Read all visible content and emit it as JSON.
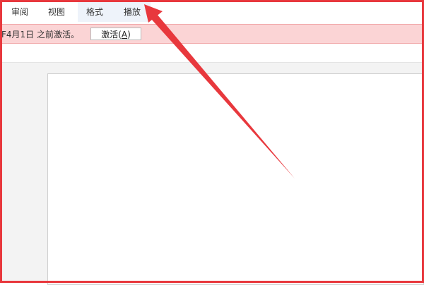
{
  "ribbon": {
    "tabs": [
      {
        "label": "审阅"
      },
      {
        "label": "视图"
      },
      {
        "label": "格式"
      },
      {
        "label": "播放"
      }
    ]
  },
  "infobar": {
    "message": "F4月1日 之前激活。",
    "activate_label": "激活",
    "activate_accel": "A"
  },
  "annotation": {
    "color": "#e8383d"
  }
}
